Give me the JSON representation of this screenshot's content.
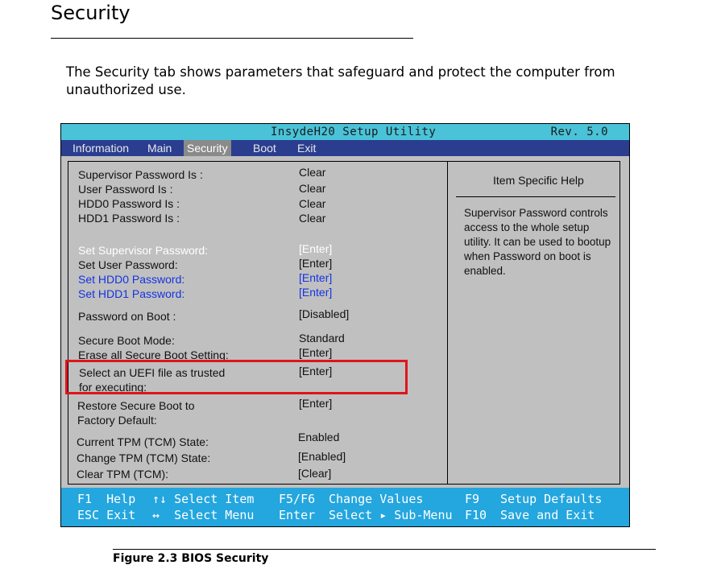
{
  "doc": {
    "section_title": "Security",
    "intro": "The Security tab shows parameters that safeguard and protect the computer from unauthorized use.",
    "caption": "Figure 2.3     BIOS Security"
  },
  "bios": {
    "title": "InsydeH20 Setup Utility",
    "rev": "Rev. 5.0",
    "menu": [
      "Information",
      "Main",
      "Security",
      "Boot",
      "Exit"
    ],
    "active_menu": "Security",
    "items": [
      {
        "label": "Supervisor Password Is :",
        "value": "Clear"
      },
      {
        "label": "User Password Is :",
        "value": "Clear"
      },
      {
        "label": "HDD0 Password Is :",
        "value": "Clear"
      },
      {
        "label": "HDD1 Password Is :",
        "value": "Clear"
      },
      {
        "label": "Set Supervisor Password:",
        "value": "[Enter]"
      },
      {
        "label": "Set User Password:",
        "value": "[Enter]"
      },
      {
        "label": "Set HDD0 Password:",
        "value": "[Enter]"
      },
      {
        "label": "Set HDD1 Password:",
        "value": "[Enter]"
      },
      {
        "label": "Password on Boot :",
        "value": "[Disabled]"
      },
      {
        "label": "Secure Boot Mode:",
        "value": "Standard"
      },
      {
        "label": "Erase all Secure Boot Setting:",
        "value": "[Enter]"
      },
      {
        "label": "Select an UEFI file as trusted",
        "label2": "for executing:",
        "value": "[Enter]"
      },
      {
        "label": "Restore Secure Boot to",
        "label2": "Factory Default:",
        "value": "[Enter]"
      },
      {
        "label": "Current TPM (TCM) State:",
        "value": "Enabled"
      },
      {
        "label": "Change TPM (TCM) State:",
        "value": "[Enabled]"
      },
      {
        "label": "Clear TPM (TCM):",
        "value": "[Clear]"
      }
    ],
    "help": {
      "title": "Item Specific Help",
      "text": "Supervisor Password controls access to the whole setup utility. It can be used to bootup when Password on boot is enabled."
    },
    "footer": {
      "f1": "F1  Help",
      "esc": "ESC Exit",
      "arrows_ud": "↑↓ Select Item",
      "arrows_lr": "↔  Select Menu",
      "f5f6": "F5/F6",
      "change_values": "Change Values",
      "enter": "Enter",
      "select_submenu": "Select ▸ Sub-Menu",
      "f9": "F9",
      "setup_defaults": "Setup Defaults",
      "f10": "F10",
      "save_exit": "Save and Exit"
    },
    "colors": {
      "titlebar": "#4ac3d8",
      "menubar": "#2a3d8f",
      "panel": "#c0c0c0",
      "footer": "#24a6df",
      "highlight_box": "#e0141a",
      "link_blue": "#1533e0"
    }
  }
}
